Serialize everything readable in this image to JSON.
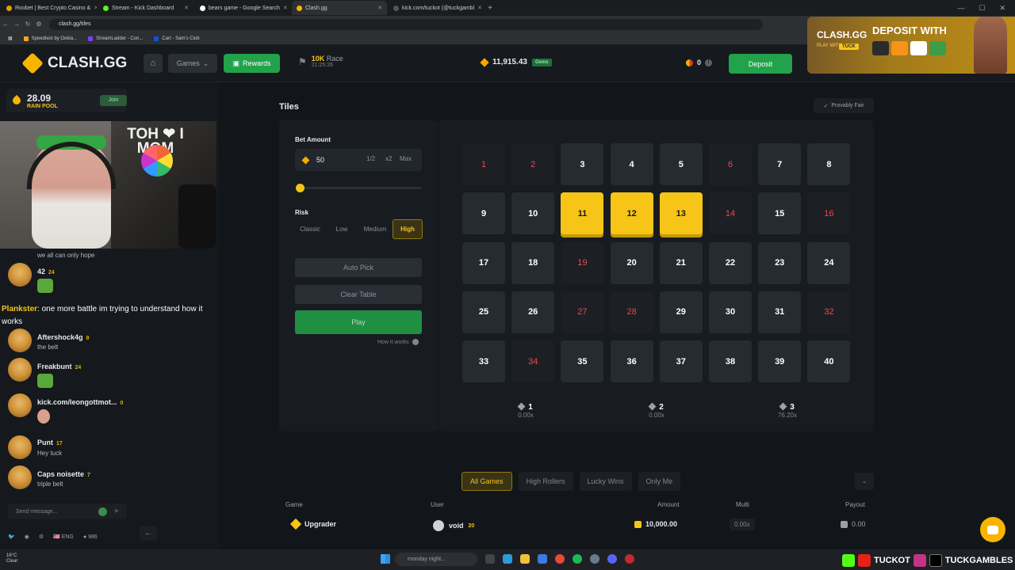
{
  "browser": {
    "tabs": [
      {
        "label": "Roobet | Best Crypto Casino &",
        "color": "#e2a100"
      },
      {
        "label": "Stream - Kick Dashboard",
        "color": "#53fc18"
      },
      {
        "label": "bears game - Google Search",
        "color": "#ffffff"
      },
      {
        "label": "Clash.gg",
        "color": "#f7b500",
        "active": true
      },
      {
        "label": "kick.com/tuckot (@tuckgambl",
        "color": "#222222"
      }
    ],
    "url": "clash.gg/tiles",
    "bookmarks": [
      "Speedtest by Ookla...",
      "StreamLadder - Con...",
      "Cart - Sam's Club"
    ]
  },
  "header": {
    "logo_text": "CLASH.GG",
    "games_label": "Games",
    "rewards_label": "Rewards",
    "race_title": "10K",
    "race_sub": "Race",
    "race_timer": "21:25:26",
    "balance": "11,915.43",
    "gems_badge": "Gems",
    "coins": "0",
    "deposit_label": "Deposit"
  },
  "sponsor": {
    "logo": "CLASH.GG",
    "play_with": "PLAY WITH",
    "code": "TUCK",
    "headline": "DEPOSIT WITH"
  },
  "sidebar": {
    "rain_amount": "28.09",
    "rain_label": "RAIN POOL",
    "join_label": "Join",
    "webcam_sign": "TOH ❤ I MOM",
    "messages": [
      {
        "text": "we all can only hope"
      },
      {
        "user": "42",
        "level": "24"
      },
      {
        "user": "Aftershock4g",
        "level": "8",
        "text": "the belt"
      },
      {
        "user": "Freakbunt",
        "level": "24"
      },
      {
        "user": "kick.com/leongottmot...",
        "level": "0"
      },
      {
        "user": "Punt",
        "level": "17",
        "text": "Hey tuck"
      },
      {
        "user": "Caps noisette",
        "level": "7",
        "text": "triple belt"
      }
    ],
    "highlight_user": "Plankster",
    "highlight_text": ": one more battle im trying to understand how it works",
    "chat_placeholder": "Send message...",
    "lang": "ENG",
    "online": "986"
  },
  "game": {
    "title": "Tiles",
    "provably_fair": "Provably Fair",
    "bet_label": "Bet Amount",
    "bet_value": "50",
    "half": "1/2",
    "double": "x2",
    "max": "Max",
    "risk_label": "Risk",
    "risk_options": [
      "Classic",
      "Low",
      "Medium",
      "High"
    ],
    "auto_pick": "Auto Pick",
    "clear_table": "Clear Table",
    "play": "Play",
    "how_it_works": "How it works"
  },
  "tiles": {
    "red": [
      1,
      2,
      6,
      14,
      16,
      19,
      27,
      28,
      32,
      34
    ],
    "selected": [
      11,
      12,
      13
    ]
  },
  "stats": [
    {
      "count": "1",
      "mult": "0.00x"
    },
    {
      "count": "2",
      "mult": "0.00x"
    },
    {
      "count": "3",
      "mult": "76.20x"
    }
  ],
  "filters": [
    "All Games",
    "High Rollers",
    "Lucky Wins",
    "Only Me"
  ],
  "table": {
    "columns": [
      "Game",
      "User",
      "Amount",
      "Multi",
      "Payout"
    ],
    "rows": [
      {
        "game": "Upgrader",
        "user": "void",
        "level": "20",
        "amount": "10,000.00",
        "multi": "0.00x",
        "payout": "0.00"
      }
    ]
  },
  "overlay": {
    "handle1": "TUCKOT",
    "handle2": "TUCKGAMBLES"
  },
  "taskbar": {
    "weather_temp": "16°C",
    "weather_desc": "Clear",
    "search_placeholder": "monday night..."
  },
  "colors": {
    "accent": "#f7c518",
    "green": "#22a24a",
    "red_tile_text": "#e84a4a"
  }
}
